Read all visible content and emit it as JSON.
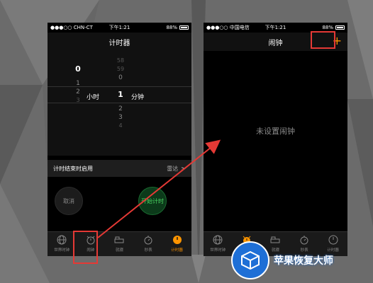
{
  "left_phone": {
    "status": {
      "carrier": "●●●○○ CHN-CT",
      "time": "下午1:21",
      "battery": "88%"
    },
    "title": "计时器",
    "picker": {
      "hours": {
        "above": [
          "",
          "",
          ""
        ],
        "selected": "0",
        "below": [
          "1",
          "2",
          "3"
        ],
        "unit": "小时"
      },
      "minutes": {
        "above": [
          "58",
          "59",
          "0"
        ],
        "selected": "1",
        "below": [
          "2",
          "3",
          "4"
        ],
        "unit": "分钟"
      }
    },
    "alert_row": {
      "label": "计时结束时启用",
      "value": "雷达",
      "chevron": ">"
    },
    "cancel_label": "取消",
    "start_label": "开始计时",
    "tabs": [
      {
        "label": "世界时钟",
        "icon": "globe-icon"
      },
      {
        "label": "闹钟",
        "icon": "alarm-clock-icon"
      },
      {
        "label": "就寝",
        "icon": "bed-icon"
      },
      {
        "label": "秒表",
        "icon": "stopwatch-icon"
      },
      {
        "label": "计时器",
        "icon": "timer-icon",
        "active": true
      }
    ]
  },
  "right_phone": {
    "status": {
      "carrier": "●●●○○ 中国电信",
      "time": "下午1:21",
      "battery": "88%"
    },
    "title": "闹钟",
    "add_label": "+",
    "empty_text": "未设置闹钟",
    "tabs": [
      {
        "label": "世界时钟",
        "icon": "globe-icon"
      },
      {
        "label": "闹钟",
        "icon": "alarm-clock-icon",
        "active": true
      },
      {
        "label": "就寝",
        "icon": "bed-icon"
      },
      {
        "label": "秒表",
        "icon": "stopwatch-icon"
      },
      {
        "label": "计时器",
        "icon": "timer-icon"
      }
    ]
  },
  "watermark": {
    "text": "苹果恢复大师"
  },
  "colors": {
    "accent": "#ff9500",
    "highlight": "#e53935",
    "start_green": "#4cd964",
    "watermark_blue": "#1e6fd6"
  }
}
